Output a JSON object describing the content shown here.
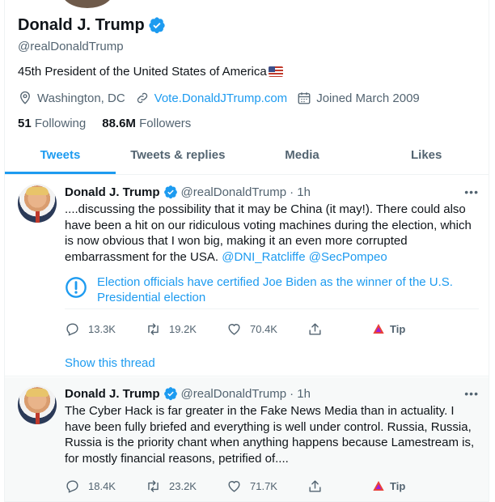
{
  "profile": {
    "name": "Donald J. Trump",
    "handle": "@realDonaldTrump",
    "bio": "45th President of the United States of America",
    "location": "Washington, DC",
    "website": "Vote.DonaldJTrump.com",
    "joined": "Joined March 2009",
    "following_count": "51",
    "following_label": "Following",
    "followers_count": "88.6M",
    "followers_label": "Followers",
    "bio_flag_icon": "us-flag-icon"
  },
  "tabs": [
    {
      "label": "Tweets",
      "active": true
    },
    {
      "label": "Tweets & replies",
      "active": false
    },
    {
      "label": "Media",
      "active": false
    },
    {
      "label": "Likes",
      "active": false
    }
  ],
  "tweets": [
    {
      "name": "Donald J. Trump",
      "handle": "@realDonaldTrump",
      "time": "· 1h",
      "more": "•••",
      "text": "....discussing the possibility that it may be China (it may!). There could also have been a hit on our ridiculous voting machines during the election, which is now obvious that I won big, making it an even more corrupted embarrassment for the USA.",
      "mention1": "@DNI_Ratcliffe",
      "mention2": "@SecPompeo",
      "notice": "Election officials have certified Joe Biden as the winner of the U.S. Presidential election",
      "replies": "13.3K",
      "retweets": "19.2K",
      "likes": "70.4K",
      "tip": "Tip",
      "show_thread": "Show this thread"
    },
    {
      "name": "Donald J. Trump",
      "handle": "@realDonaldTrump",
      "time": "· 1h",
      "more": "•••",
      "text": "The Cyber Hack is far greater in the Fake News Media than in actuality. I have been fully briefed and everything is well under control. Russia, Russia, Russia is the priority chant when anything happens because Lamestream is, for mostly financial reasons, petrified of....",
      "replies": "18.4K",
      "retweets": "23.2K",
      "likes": "71.7K",
      "tip": "Tip"
    }
  ],
  "colors": {
    "accent": "#1d9bf0",
    "text": "#0f1419",
    "secondary": "#536471",
    "tip_brand": "#e8423a"
  }
}
